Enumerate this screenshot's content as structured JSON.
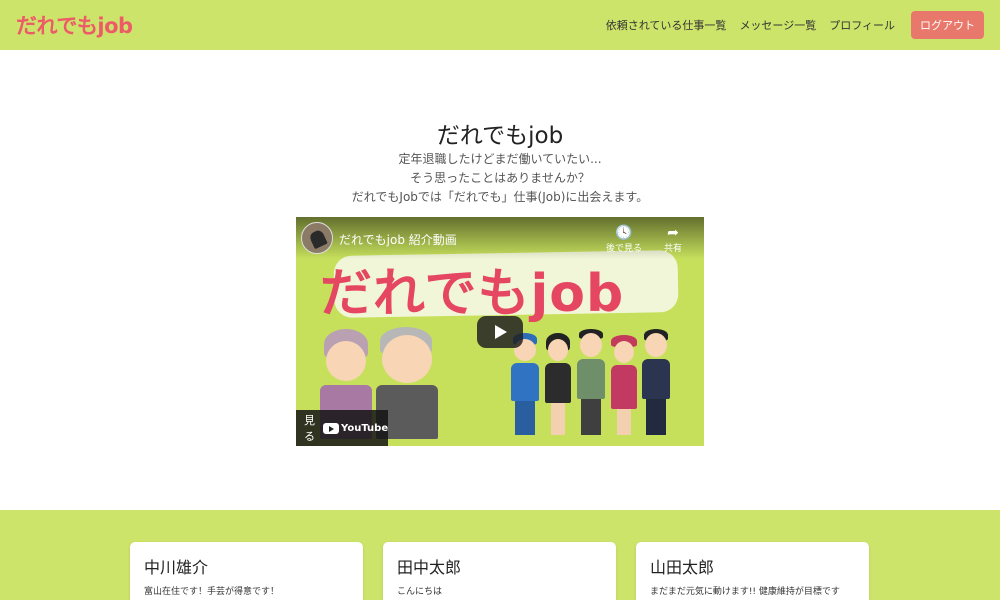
{
  "header": {
    "brand": "だれでもjob",
    "nav": [
      "依頼されている仕事一覧",
      "メッセージ一覧",
      "プロフィール"
    ],
    "logout_label": "ログアウト"
  },
  "hero": {
    "title": "だれでもjob",
    "lines": [
      "定年退職したけどまだ働いていたい...",
      "そう思ったことはありませんか？",
      "だれでもJobでは「だれでも」仕事(Job)に出会えます。"
    ]
  },
  "video": {
    "title": "だれでもjob 紹介動画",
    "watch_later": "後で見る",
    "share": "共有",
    "big_title": "だれでもjob",
    "watch_on": "見る",
    "youtube": "YouTube"
  },
  "cards": [
    {
      "name": "中川雄介",
      "text": "富山在住です！手芸が得意です！"
    },
    {
      "name": "田中太郎",
      "text": "こんにちは"
    },
    {
      "name": "山田太郎",
      "text": "まだまだ元気に動けます!! 健康維持が目標です"
    }
  ],
  "colors": {
    "navbar": "#cde46a",
    "brand": "#ec5b67",
    "logout": "#e8786b",
    "video_bg": "#c6e05c",
    "video_title": "#e54661"
  }
}
